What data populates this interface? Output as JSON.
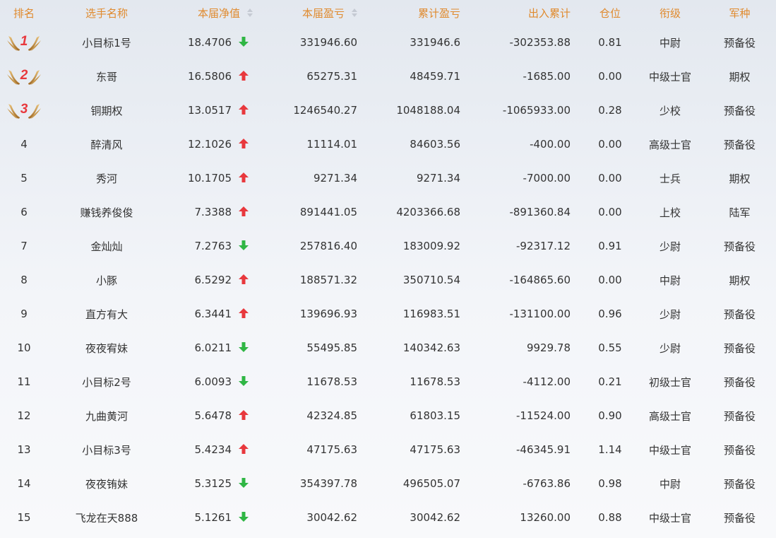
{
  "headers": {
    "rank": "排名",
    "name": "选手名称",
    "nav": "本届净值",
    "pnl": "本届盈亏",
    "total_pnl": "累计盈亏",
    "inout": "出入累计",
    "position": "仓位",
    "title": "衔级",
    "branch": "军种"
  },
  "colors": {
    "header_text": "#e08a2e",
    "up": "#e8383d",
    "down": "#2fb644",
    "text": "#333333"
  },
  "rows": [
    {
      "rank": "1",
      "badge": true,
      "name": "小目标1号",
      "nav": "18.4706",
      "trend": "down",
      "pnl": "331946.60",
      "total_pnl": "331946.6",
      "inout": "-302353.88",
      "position": "0.81",
      "title": "中尉",
      "branch": "预备役"
    },
    {
      "rank": "2",
      "badge": true,
      "name": "东哥",
      "nav": "16.5806",
      "trend": "up",
      "pnl": "65275.31",
      "total_pnl": "48459.71",
      "inout": "-1685.00",
      "position": "0.00",
      "title": "中级士官",
      "branch": "期权"
    },
    {
      "rank": "3",
      "badge": true,
      "name": "铜期权",
      "nav": "13.0517",
      "trend": "up",
      "pnl": "1246540.27",
      "total_pnl": "1048188.04",
      "inout": "-1065933.00",
      "position": "0.28",
      "title": "少校",
      "branch": "预备役"
    },
    {
      "rank": "4",
      "badge": false,
      "name": "醉清风",
      "nav": "12.1026",
      "trend": "up",
      "pnl": "11114.01",
      "total_pnl": "84603.56",
      "inout": "-400.00",
      "position": "0.00",
      "title": "高级士官",
      "branch": "预备役"
    },
    {
      "rank": "5",
      "badge": false,
      "name": "秀河",
      "nav": "10.1705",
      "trend": "up",
      "pnl": "9271.34",
      "total_pnl": "9271.34",
      "inout": "-7000.00",
      "position": "0.00",
      "title": "士兵",
      "branch": "期权"
    },
    {
      "rank": "6",
      "badge": false,
      "name": "赚钱养俊俊",
      "nav": "7.3388",
      "trend": "up",
      "pnl": "891441.05",
      "total_pnl": "4203366.68",
      "inout": "-891360.84",
      "position": "0.00",
      "title": "上校",
      "branch": "陆军"
    },
    {
      "rank": "7",
      "badge": false,
      "name": "金灿灿",
      "nav": "7.2763",
      "trend": "down",
      "pnl": "257816.40",
      "total_pnl": "183009.92",
      "inout": "-92317.12",
      "position": "0.91",
      "title": "少尉",
      "branch": "预备役"
    },
    {
      "rank": "8",
      "badge": false,
      "name": "小豚",
      "nav": "6.5292",
      "trend": "up",
      "pnl": "188571.32",
      "total_pnl": "350710.54",
      "inout": "-164865.60",
      "position": "0.00",
      "title": "中尉",
      "branch": "期权"
    },
    {
      "rank": "9",
      "badge": false,
      "name": "直方有大",
      "nav": "6.3441",
      "trend": "up",
      "pnl": "139696.93",
      "total_pnl": "116983.51",
      "inout": "-131100.00",
      "position": "0.96",
      "title": "少尉",
      "branch": "预备役"
    },
    {
      "rank": "10",
      "badge": false,
      "name": "夜夜宥妹",
      "nav": "6.0211",
      "trend": "down",
      "pnl": "55495.85",
      "total_pnl": "140342.63",
      "inout": "9929.78",
      "position": "0.55",
      "title": "少尉",
      "branch": "预备役"
    },
    {
      "rank": "11",
      "badge": false,
      "name": "小目标2号",
      "nav": "6.0093",
      "trend": "down",
      "pnl": "11678.53",
      "total_pnl": "11678.53",
      "inout": "-4112.00",
      "position": "0.21",
      "title": "初级士官",
      "branch": "预备役"
    },
    {
      "rank": "12",
      "badge": false,
      "name": "九曲黄河",
      "nav": "5.6478",
      "trend": "up",
      "pnl": "42324.85",
      "total_pnl": "61803.15",
      "inout": "-11524.00",
      "position": "0.90",
      "title": "高级士官",
      "branch": "预备役"
    },
    {
      "rank": "13",
      "badge": false,
      "name": "小目标3号",
      "nav": "5.4234",
      "trend": "up",
      "pnl": "47175.63",
      "total_pnl": "47175.63",
      "inout": "-46345.91",
      "position": "1.14",
      "title": "中级士官",
      "branch": "预备役"
    },
    {
      "rank": "14",
      "badge": false,
      "name": "夜夜铕妹",
      "nav": "5.3125",
      "trend": "down",
      "pnl": "354397.78",
      "total_pnl": "496505.07",
      "inout": "-6763.86",
      "position": "0.98",
      "title": "中尉",
      "branch": "预备役"
    },
    {
      "rank": "15",
      "badge": false,
      "name": "飞龙在天888",
      "nav": "5.1261",
      "trend": "down",
      "pnl": "30042.62",
      "total_pnl": "30042.62",
      "inout": "13260.00",
      "position": "0.88",
      "title": "中级士官",
      "branch": "预备役"
    }
  ]
}
